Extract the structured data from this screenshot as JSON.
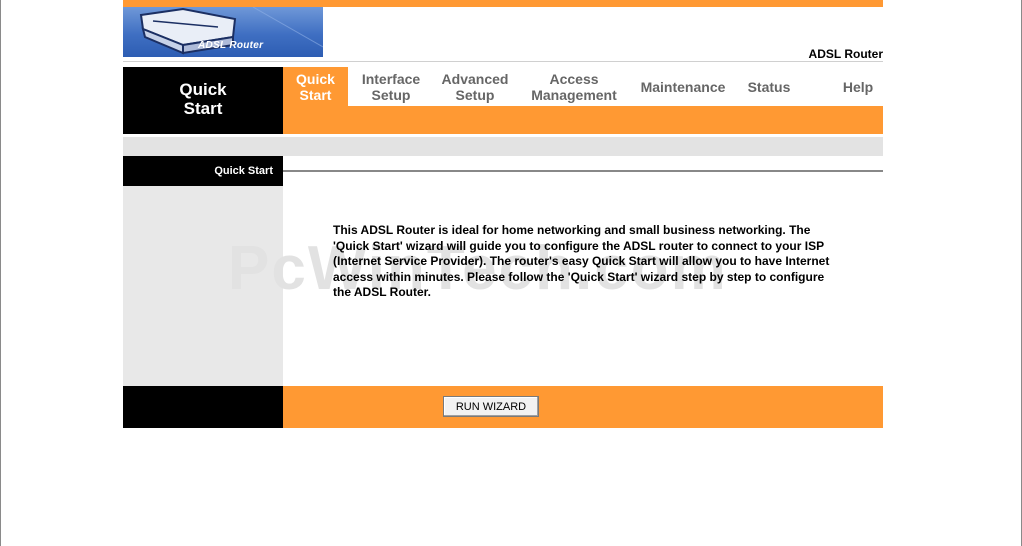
{
  "header": {
    "logo_text": "ADSL Router",
    "product_name": "ADSL Router"
  },
  "nav": {
    "section_title": "Quick\nStart",
    "tabs": [
      {
        "label": "Quick\nStart",
        "active": true
      },
      {
        "label": "Interface\nSetup",
        "active": false
      },
      {
        "label": "Advanced\nSetup",
        "active": false
      },
      {
        "label": "Access\nManagement",
        "active": false
      },
      {
        "label": "Maintenance",
        "active": false
      },
      {
        "label": "Status",
        "active": false
      },
      {
        "label": "Help",
        "active": false
      }
    ]
  },
  "content": {
    "subheader": "Quick Start",
    "description": "This ADSL Router is ideal for home networking and small business networking. The 'Quick Start' wizard will guide you to configure the ADSL router to connect to your ISP (Internet Service Provider). The router's easy Quick Start will allow you to have Internet access within minutes. Please follow the 'Quick Start' wizard step by step to configure the ADSL Router.",
    "watermark": "PcWinTech.com"
  },
  "footer": {
    "run_wizard_label": "RUN WIZARD"
  },
  "colors": {
    "accent": "#ff9933",
    "dark": "#000000",
    "panel_gray": "#e8e8e8"
  }
}
